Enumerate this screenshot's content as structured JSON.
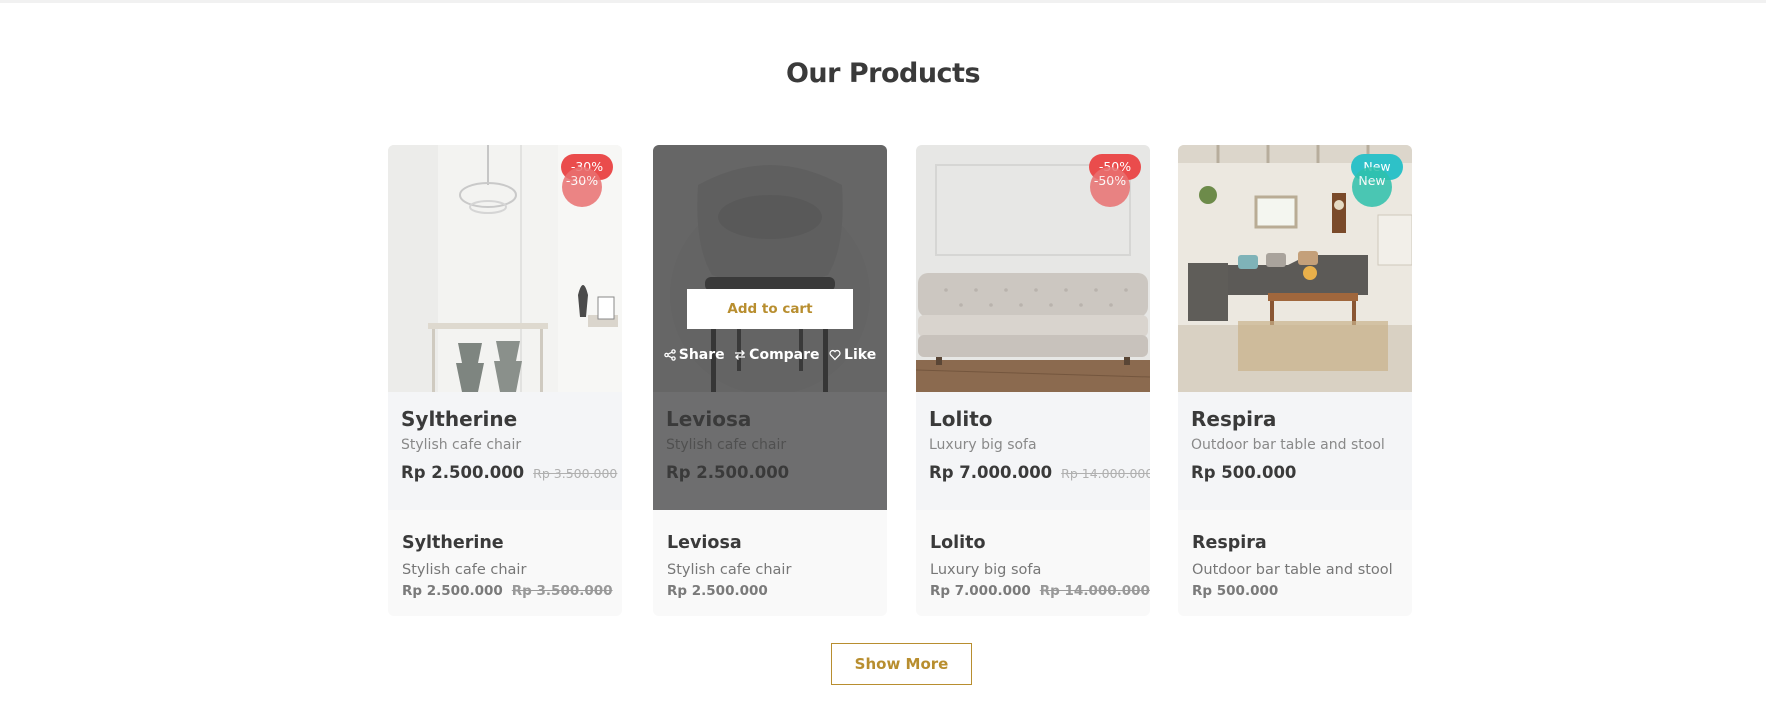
{
  "section_title": "Our Products",
  "colors": {
    "accent": "#b88e2f",
    "discount": "#e97171",
    "new": "#2ec1ac"
  },
  "products": [
    {
      "name": "Syltherine",
      "subtitle": "Stylish cafe chair",
      "price": "Rp 2.500.000",
      "old_price": "Rp 3.500.000",
      "badge": "-30%"
    },
    {
      "name": "Leviosa",
      "subtitle": "Stylish cafe chair",
      "price": "Rp 2.500.000",
      "old_price": "",
      "badge": ""
    },
    {
      "name": "Lolito",
      "subtitle": "Luxury big sofa",
      "price": "Rp 7.000.000",
      "old_price": "Rp 14.000.000",
      "badge": "-50%"
    },
    {
      "name": "Respira",
      "subtitle": "Outdoor bar table and stool",
      "price": "Rp 500.000",
      "old_price": "",
      "badge": "New"
    }
  ],
  "hover": {
    "add_to_cart": "Add to cart",
    "share": "Share",
    "compare": "Compare",
    "like": "Like"
  },
  "show_more": "Show More"
}
